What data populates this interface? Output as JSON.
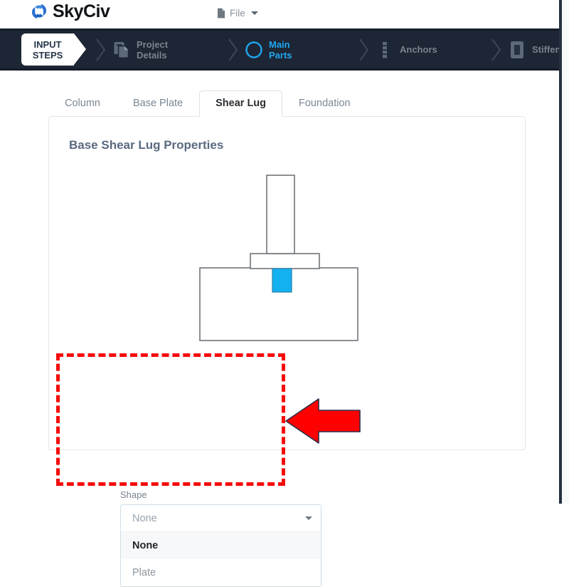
{
  "header": {
    "brand_name": "SkyCiv",
    "brand_icon": "skyciv-hexagon-logo",
    "file_menu": {
      "label": "File",
      "icon": "document-icon",
      "caret_icon": "chevron-down-icon"
    }
  },
  "steps_bar": {
    "title": "INPUT\nSTEPS",
    "items": [
      {
        "label": "Project\nDetails",
        "icon": "copy-documents-icon",
        "active": false
      },
      {
        "label": "Main\nParts",
        "icon": "circle-icon",
        "active": true
      },
      {
        "label": "Anchors",
        "icon": "vertical-dots-icon",
        "active": false
      },
      {
        "label": "Stiffeners",
        "icon": "plate-rect-icon",
        "active": false
      }
    ],
    "active_color": "#1ea7f0",
    "inactive_color": "#79838f",
    "background": "#1d2634"
  },
  "tabs": [
    {
      "label": "Column",
      "active": false
    },
    {
      "label": "Base Plate",
      "active": false
    },
    {
      "label": "Shear Lug",
      "active": true
    },
    {
      "label": "Foundation",
      "active": false
    }
  ],
  "card": {
    "title": "Base Shear Lug Properties",
    "figure": {
      "name": "shear-lug-elevation-diagram",
      "parts": [
        {
          "name": "column",
          "fill": "#ffffff",
          "stroke": "#6f7479"
        },
        {
          "name": "base-plate",
          "fill": "#ffffff",
          "stroke": "#6f7479"
        },
        {
          "name": "shear-lug",
          "fill": "#14b1f0",
          "stroke": "#2a7fa8"
        },
        {
          "name": "foundation",
          "fill": "#ffffff",
          "stroke": "#6f7479"
        }
      ]
    }
  },
  "shape_field": {
    "label": "Shape",
    "selected_value": "None",
    "placeholder": "None",
    "caret_icon": "chevron-down-icon",
    "options": [
      {
        "label": "None",
        "selected": true
      },
      {
        "label": "Plate",
        "selected": false
      }
    ]
  },
  "annotation": {
    "box_color": "#f60b0b",
    "arrow_color": "#fd0000",
    "arrow_icon": "left-arrow-annotation",
    "box_name": "highlight-dashed-rectangle"
  }
}
